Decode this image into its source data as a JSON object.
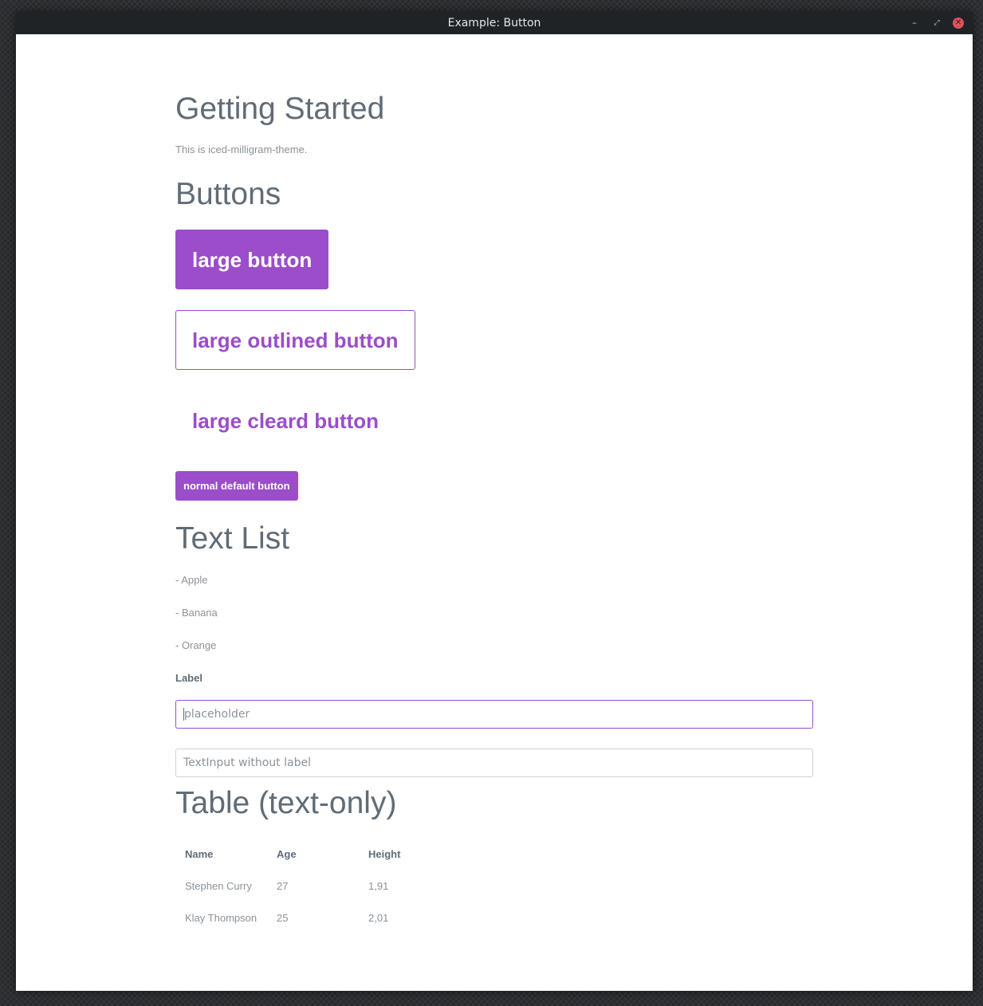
{
  "window": {
    "title": "Example: Button",
    "controls": {
      "minimize": "–",
      "maximize": "⤢",
      "close": "✕"
    }
  },
  "getting_started": {
    "heading": "Getting Started",
    "text": "This is iced-milligram-theme."
  },
  "buttons": {
    "heading": "Buttons",
    "large_button": "large button",
    "large_outlined_button": "large outlined button",
    "large_cleared_button": "large cleard button",
    "normal_default_button": "normal default button"
  },
  "text_list": {
    "heading": "Text List",
    "items": [
      "- Apple",
      "- Banana",
      "- Orange"
    ]
  },
  "inputs": {
    "label": "Label",
    "labeled_placeholder": "placeholder",
    "unlabeled_placeholder": "TextInput without label"
  },
  "table": {
    "heading": "Table (text-only)",
    "columns": [
      "Name",
      "Age",
      "Height"
    ],
    "rows": [
      [
        "Stephen Curry",
        "27",
        "1,91"
      ],
      [
        "Klay Thompson",
        "25",
        "2,01"
      ]
    ]
  },
  "colors": {
    "accent": "#9b4dca",
    "text": "#606c76",
    "muted": "#8a939b"
  }
}
